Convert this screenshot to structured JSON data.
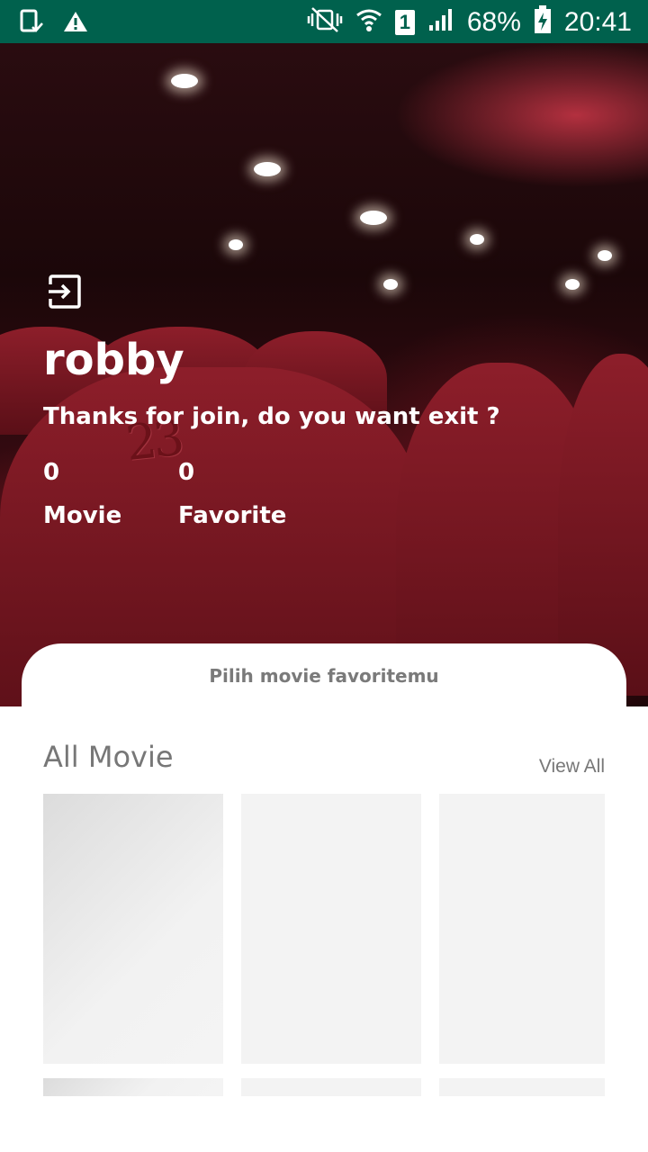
{
  "status_bar": {
    "battery": "68%",
    "time": "20:41",
    "sim": "1",
    "icons": [
      "phone-check-icon",
      "warning-icon",
      "vibrate-icon",
      "wifi-icon",
      "sim-icon",
      "signal-icon",
      "battery-charging-icon"
    ]
  },
  "profile": {
    "exit_icon": "exit-icon",
    "username": "robby",
    "message": "Thanks for join, do you want exit ?",
    "stats": [
      {
        "value": "0",
        "label": "Movie"
      },
      {
        "value": "0",
        "label": "Favorite"
      }
    ]
  },
  "hero_image": {
    "seat_number": "23"
  },
  "card": {
    "text": "Pilih movie favoritemu"
  },
  "all_movie": {
    "title": "All Movie",
    "view_all": "View All"
  },
  "colors": {
    "status_bar": "#00614d",
    "placeholder": "#f3f3f3",
    "muted_text": "#777777"
  }
}
